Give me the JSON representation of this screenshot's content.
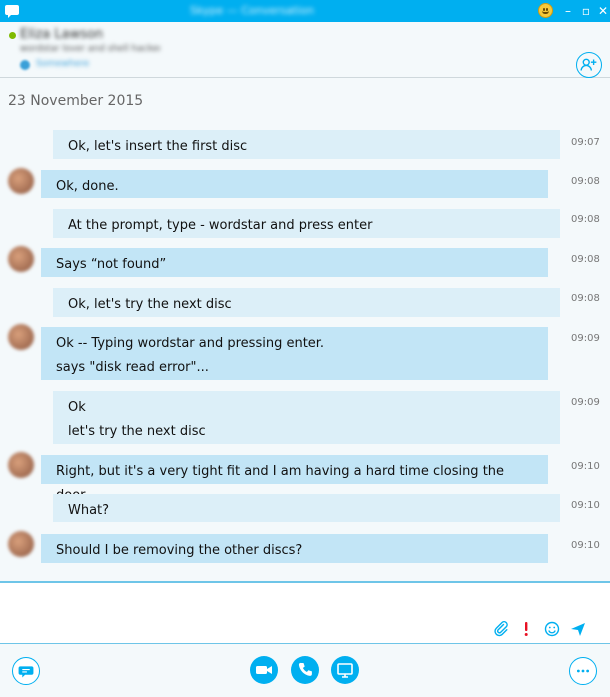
{
  "window": {
    "title": "Skype — Conversation"
  },
  "header": {
    "contact_name": "Eliza Lawson",
    "mood": "wordstar lover and shell hacker",
    "location": "Somewhere"
  },
  "conversation": {
    "date": "23 November 2015",
    "messages": [
      {
        "direction": "out",
        "lines": [
          "Ok, let's insert the first disc"
        ],
        "time": "09:07"
      },
      {
        "direction": "in",
        "lines": [
          "Ok, done."
        ],
        "time": "09:08"
      },
      {
        "direction": "out",
        "lines": [
          "At the prompt, type - wordstar and press enter"
        ],
        "time": "09:08"
      },
      {
        "direction": "in",
        "lines": [
          "Says “not found”"
        ],
        "time": "09:08"
      },
      {
        "direction": "out",
        "lines": [
          "Ok, let's try the next disc"
        ],
        "time": "09:08"
      },
      {
        "direction": "in",
        "lines": [
          "Ok -- Typing wordstar and pressing enter.",
          "says \"disk read error\"..."
        ],
        "time": "09:09"
      },
      {
        "direction": "out",
        "lines": [
          "Ok",
          "let's try the next disc"
        ],
        "time": "09:09"
      },
      {
        "direction": "in",
        "lines": [
          "Right, but it's a very tight fit and I am having a hard time closing the door."
        ],
        "time": "09:10"
      },
      {
        "direction": "out",
        "lines": [
          "What?"
        ],
        "time": "09:10"
      },
      {
        "direction": "in",
        "lines": [
          "Should I be removing the other discs?"
        ],
        "time": "09:10"
      }
    ]
  },
  "compose": {
    "value": "",
    "placeholder": ""
  },
  "colors": {
    "accent": "#00aff0",
    "bubble_out": "#dceff8",
    "bubble_in": "#c2e5f6",
    "presence": "#7fba00",
    "important": "#e81123"
  },
  "icons": {
    "titlebar": [
      "skype-icon",
      "emoticon-icon",
      "minimize-icon",
      "maximize-icon",
      "close-icon"
    ],
    "header": [
      "add-people-icon"
    ],
    "compose": [
      "paperclip-icon",
      "exclamation-icon",
      "smiley-icon",
      "send-icon"
    ],
    "bottom": [
      "chat-icon",
      "video-call-icon",
      "voice-call-icon",
      "screen-share-icon",
      "more-icon"
    ]
  }
}
